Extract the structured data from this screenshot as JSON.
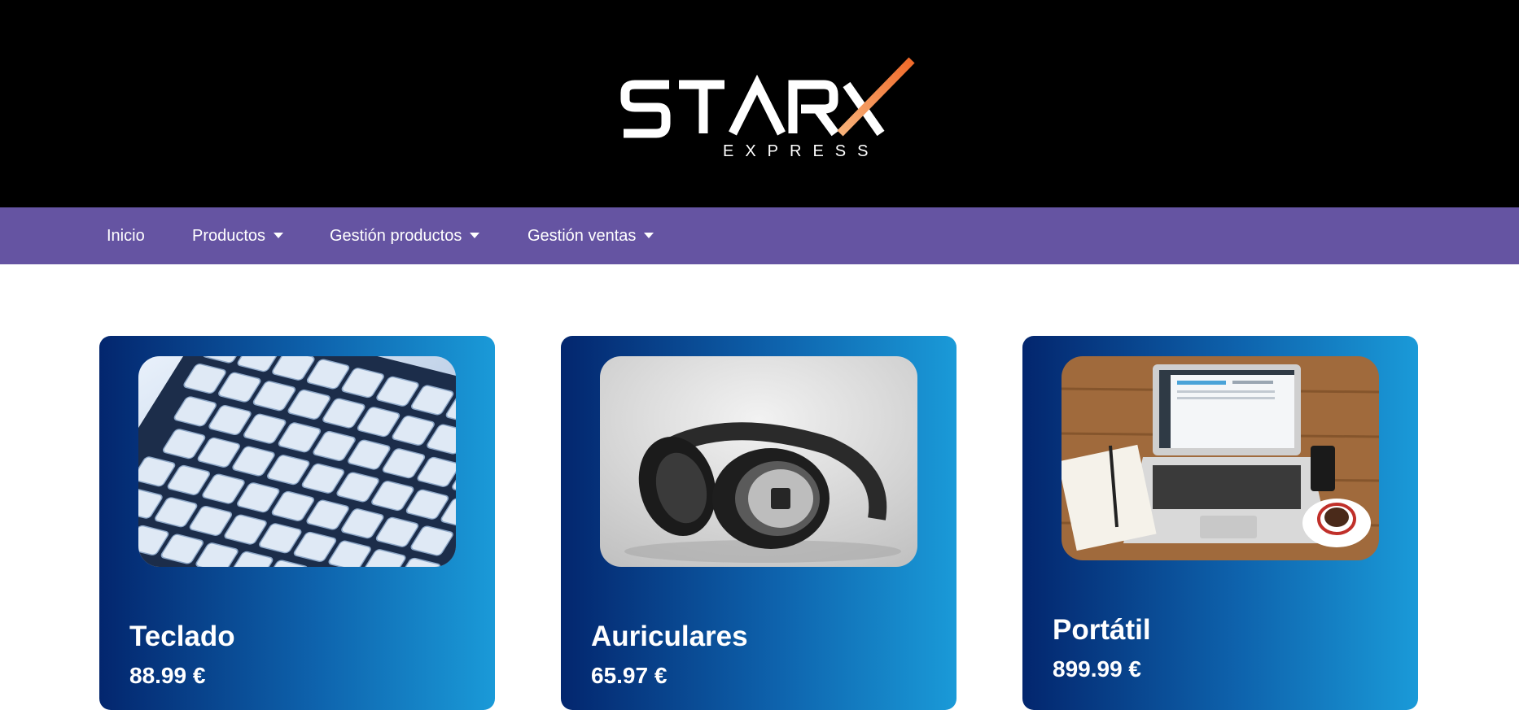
{
  "header": {
    "logo_main": "STARX",
    "logo_sub": "EXPRESS"
  },
  "nav": {
    "items": [
      {
        "label": "Inicio",
        "dropdown": false
      },
      {
        "label": "Productos",
        "dropdown": true
      },
      {
        "label": "Gestión productos",
        "dropdown": true
      },
      {
        "label": "Gestión ventas",
        "dropdown": true
      }
    ]
  },
  "colors": {
    "header_bg": "#000000",
    "navbar_bg": "#6554a2",
    "card_gradient_start": "#03266e",
    "card_gradient_end": "#1a9ad8"
  },
  "products": [
    {
      "name": "Teclado",
      "price": "88.99 €",
      "image": "keyboard-image"
    },
    {
      "name": "Auriculares",
      "price": "65.97 €",
      "image": "headphones-image"
    },
    {
      "name": "Portátil",
      "price": "899.99 €",
      "image": "laptop-desk-image"
    }
  ]
}
